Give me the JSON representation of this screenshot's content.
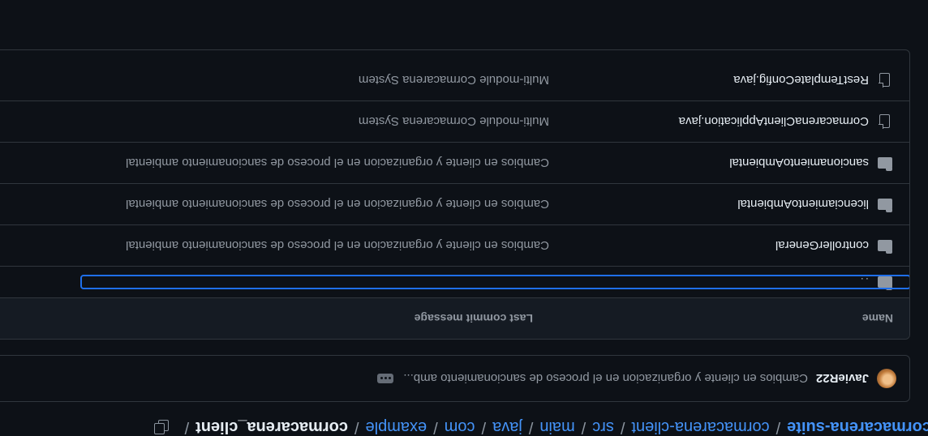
{
  "breadcrumb": {
    "items": [
      "cormacarena-suite",
      "cormacarena-client",
      "src",
      "main",
      "java",
      "com",
      "example"
    ],
    "current": "cormacarena_client",
    "separator": "/"
  },
  "latest_commit": {
    "author": "JavieR22",
    "message": "Cambios en cliente y organizacion en el proceso de sancionamiento amb..."
  },
  "table": {
    "headers": {
      "name": "Name",
      "last_commit_message": "Last commit message"
    },
    "parent_dir": "..",
    "rows": [
      {
        "type": "folder",
        "icon": "folder-icon",
        "name": "controllerGeneral",
        "message": "Cambios en cliente y organizacion en el proceso de sancionamiento ambiental"
      },
      {
        "type": "folder",
        "icon": "folder-icon",
        "name": "licenciamientoAmbiental",
        "message": "Cambios en cliente y organizacion en el proceso de sancionamiento ambiental"
      },
      {
        "type": "folder",
        "icon": "folder-icon",
        "name": "sancionamientoAmbiental",
        "message": "Cambios en cliente y organizacion en el proceso de sancionamiento ambiental"
      },
      {
        "type": "file",
        "icon": "file-icon",
        "name": "CormacarenaClientApplication.java",
        "message": "Multi-module Cormacarena System"
      },
      {
        "type": "file",
        "icon": "file-icon",
        "name": "RestTemplateConfig.java",
        "message": "Multi-module Cormacarena System"
      }
    ]
  },
  "colors": {
    "background": "#0d1117",
    "border": "#30363d",
    "link": "#4493f8",
    "muted": "#9198a1",
    "focus": "#1f6feb"
  }
}
